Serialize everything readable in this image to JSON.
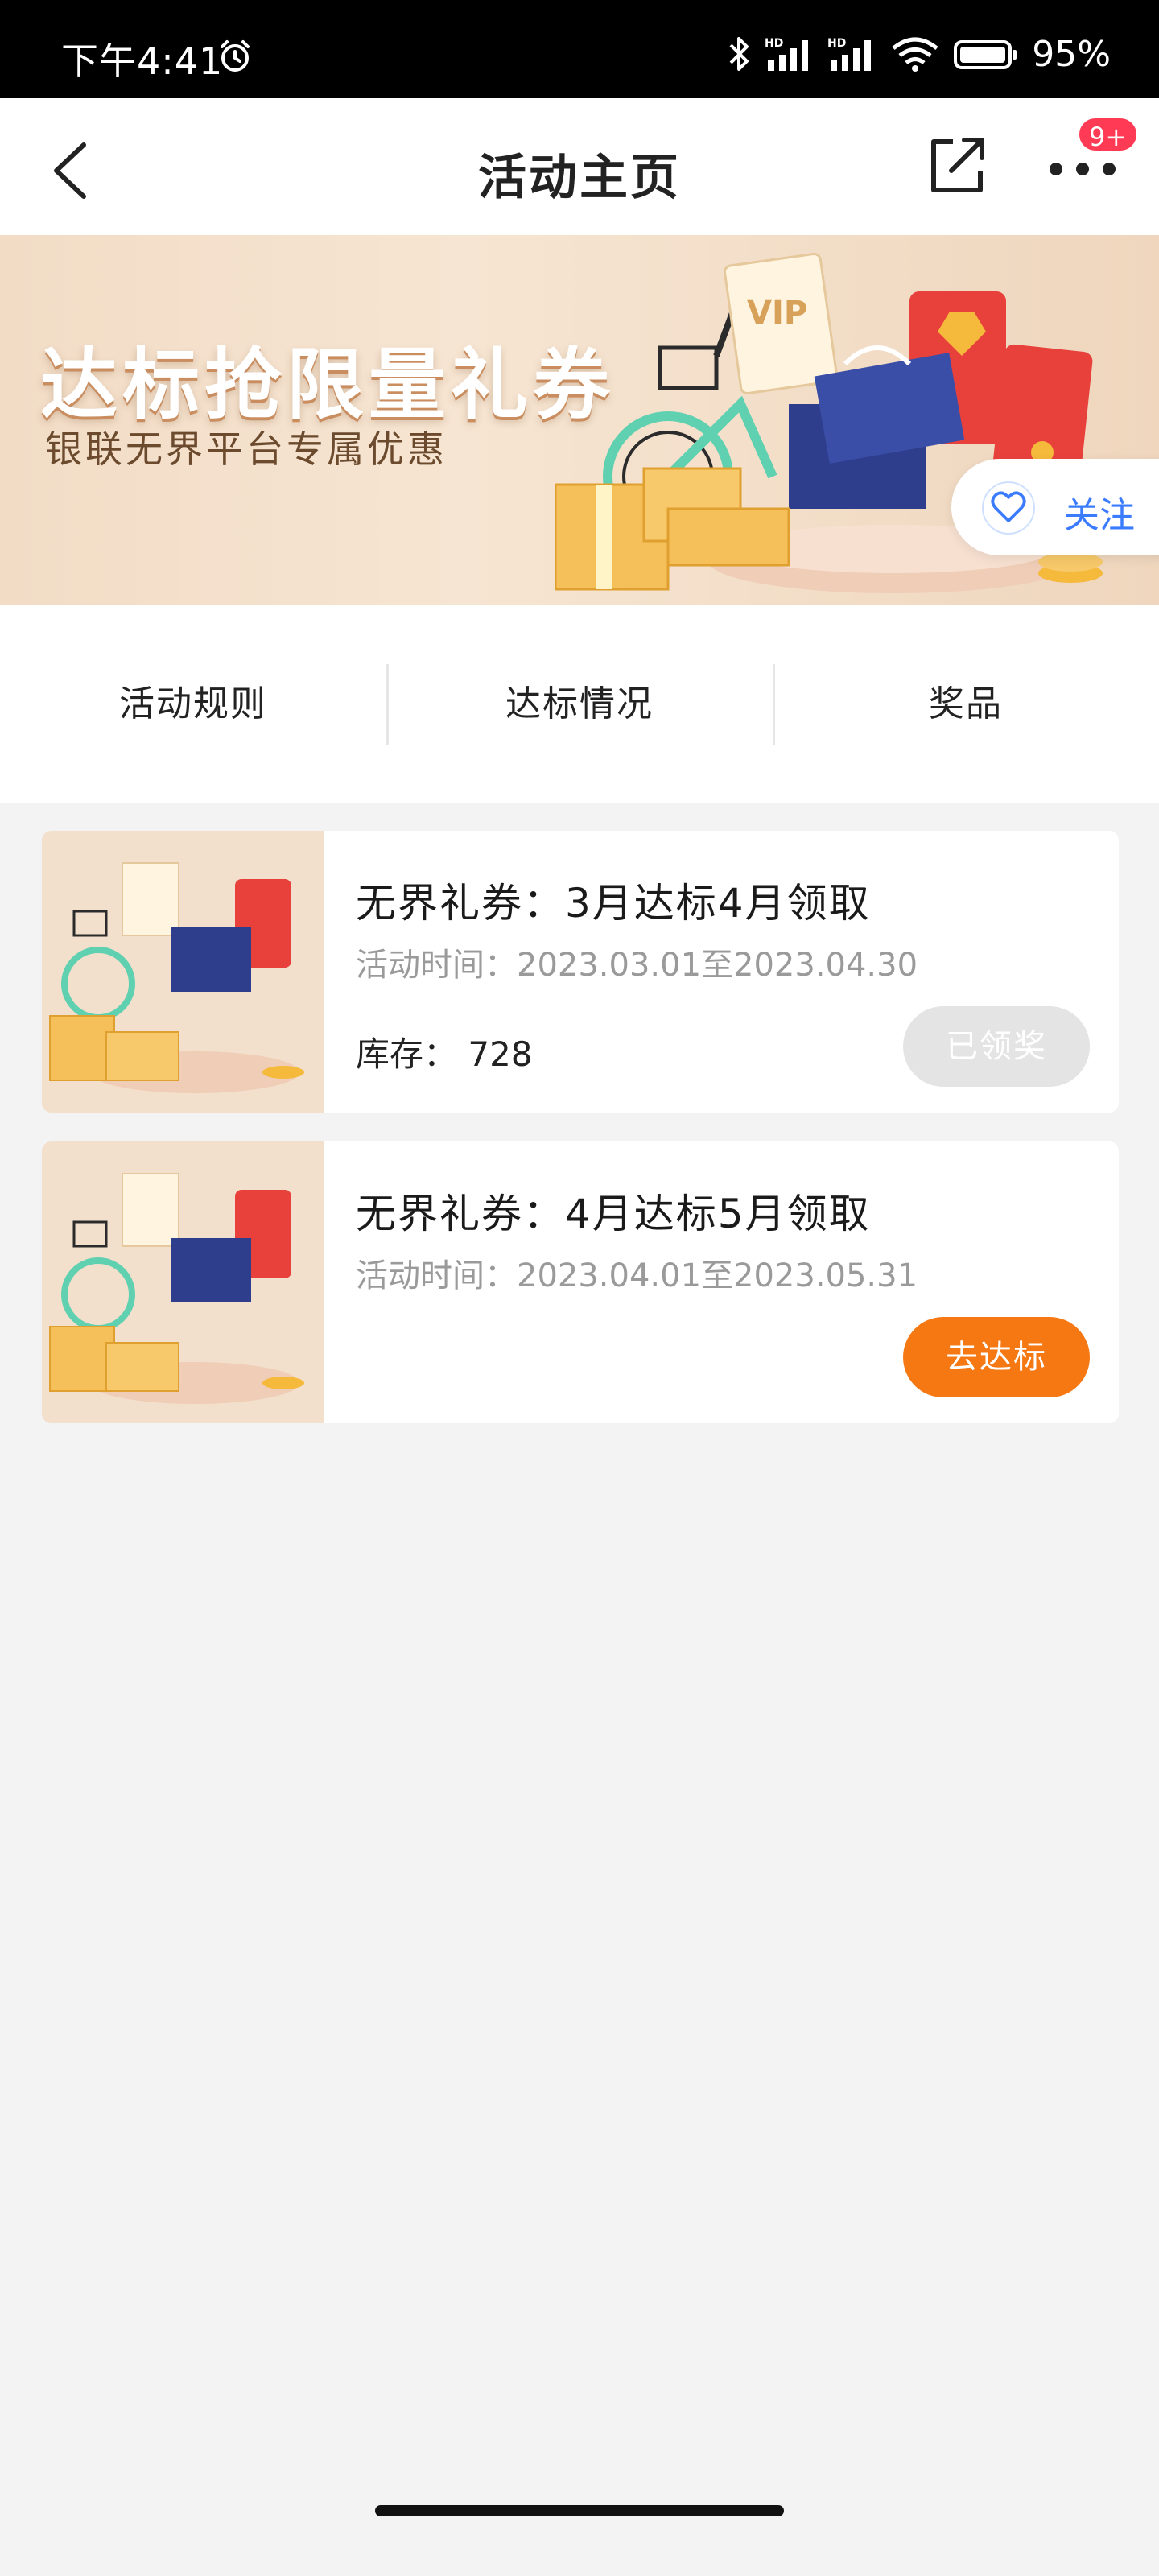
{
  "status_bar": {
    "time": "下午4:41",
    "battery": "95%",
    "icons": [
      "alarm-icon",
      "bluetooth-icon",
      "signal-hd-icon",
      "signal-hd-icon",
      "wifi-icon",
      "battery-icon"
    ]
  },
  "nav": {
    "title": "活动主页",
    "badge": "9+",
    "icons": [
      "back-chevron-icon",
      "share-external-icon",
      "more-dots-icon"
    ]
  },
  "banner": {
    "title": "达标抢限量礼券",
    "subtitle": "银联无界平台专属优惠",
    "follow_label": "关注",
    "art_text": "VIP",
    "colors": {
      "bg": "#f2dcc6",
      "accent": "#f5b93b",
      "bike": "#5fd0b0",
      "red": "#e8413c",
      "blue": "#2f3e8c"
    }
  },
  "tabs": [
    {
      "label": "活动规则"
    },
    {
      "label": "达标情况"
    },
    {
      "label": "奖品"
    }
  ],
  "cards": [
    {
      "title": "无界礼券：3月达标4月领取",
      "time": "活动时间：2023.03.01至2023.04.30",
      "stock": "库存：  728",
      "button": "已领奖",
      "button_state": "disabled"
    },
    {
      "title": "无界礼券：4月达标5月领取",
      "time": "活动时间：2023.04.01至2023.05.31",
      "button": "去达标",
      "button_state": "primary"
    }
  ],
  "colors": {
    "primary_orange": "#f57813",
    "disabled_gray": "#e4e4e4",
    "badge_red": "#ff3a55",
    "follow_blue": "#3b7cff",
    "page_bg": "#f3f3f3"
  }
}
